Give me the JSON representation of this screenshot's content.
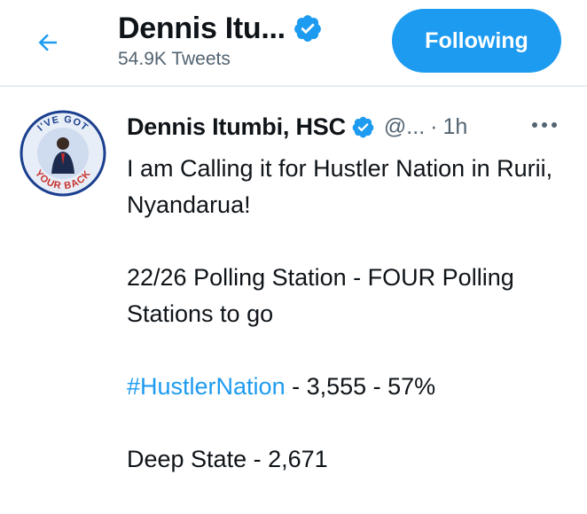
{
  "header": {
    "back_icon": "arrow-left-icon",
    "title": "Dennis Itu...",
    "tweet_count": "54.9K Tweets",
    "follow_label": "Following"
  },
  "tweet": {
    "avatar_text_top": "I'VE GOT",
    "avatar_text_bottom": "YOUR BACK",
    "author_name": "Dennis Itumbi, HSC",
    "handle": "@...",
    "separator": "·",
    "time": "1h",
    "more_icon": "more-dots-icon",
    "line1": "I am Calling it for Hustler Nation in Rurii, Nyandarua!",
    "line2": "22/26 Polling Station - FOUR Polling Stations to go",
    "hashtag": "#HustlerNation",
    "line3_rest": " - 3,555 - 57%",
    "line4": "Deep State - 2,671"
  },
  "colors": {
    "accent": "#1d9bf0",
    "text_primary": "#0f1419",
    "text_secondary": "#536471"
  }
}
